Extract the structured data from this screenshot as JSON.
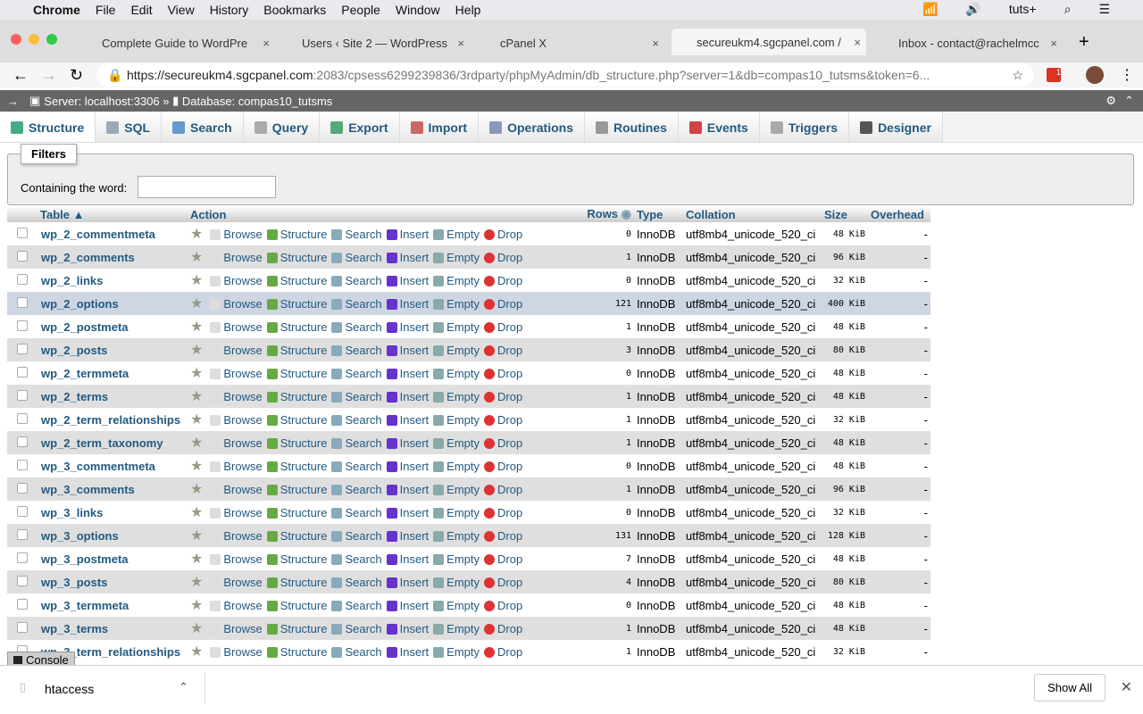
{
  "menubar": {
    "app": "Chrome",
    "items": [
      "File",
      "Edit",
      "View",
      "History",
      "Bookmarks",
      "People",
      "Window",
      "Help"
    ],
    "user": "tuts+"
  },
  "tabs": [
    {
      "title": "Complete Guide to WordPre"
    },
    {
      "title": "Users ‹ Site 2 — WordPress"
    },
    {
      "title": "cPanel X"
    },
    {
      "title": "secureukm4.sgcpanel.com /",
      "active": true
    },
    {
      "title": "Inbox - contact@rachelmcc"
    }
  ],
  "address": {
    "host": "https://secureukm4.sgcpanel.com",
    "path": ":2083/cpsess6299239836/3rdparty/phpMyAdmin/db_structure.php?server=1&db=compas10_tutsms&token=6..."
  },
  "extension_badge": "1",
  "breadcrumb": {
    "server": "Server: localhost:3306",
    "sep": "»",
    "database": "Database: compas10_tutsms"
  },
  "nav": [
    "Structure",
    "SQL",
    "Search",
    "Query",
    "Export",
    "Import",
    "Operations",
    "Routines",
    "Events",
    "Triggers",
    "Designer"
  ],
  "filters": {
    "legend": "Filters",
    "label": "Containing the word:",
    "value": ""
  },
  "columns": {
    "table": "Table",
    "action": "Action",
    "rows": "Rows",
    "type": "Type",
    "collation": "Collation",
    "size": "Size",
    "overhead": "Overhead"
  },
  "actions": [
    "Browse",
    "Structure",
    "Search",
    "Insert",
    "Empty",
    "Drop"
  ],
  "tables": [
    {
      "name": "wp_2_commentmeta",
      "rows": "0",
      "type": "InnoDB",
      "collation": "utf8mb4_unicode_520_ci",
      "size": "48 KiB",
      "overhead": "-"
    },
    {
      "name": "wp_2_comments",
      "rows": "1",
      "type": "InnoDB",
      "collation": "utf8mb4_unicode_520_ci",
      "size": "96 KiB",
      "overhead": "-"
    },
    {
      "name": "wp_2_links",
      "rows": "0",
      "type": "InnoDB",
      "collation": "utf8mb4_unicode_520_ci",
      "size": "32 KiB",
      "overhead": "-"
    },
    {
      "name": "wp_2_options",
      "rows": "121",
      "type": "InnoDB",
      "collation": "utf8mb4_unicode_520_ci",
      "size": "400 KiB",
      "overhead": "-",
      "highlight": true
    },
    {
      "name": "wp_2_postmeta",
      "rows": "1",
      "type": "InnoDB",
      "collation": "utf8mb4_unicode_520_ci",
      "size": "48 KiB",
      "overhead": "-"
    },
    {
      "name": "wp_2_posts",
      "rows": "3",
      "type": "InnoDB",
      "collation": "utf8mb4_unicode_520_ci",
      "size": "80 KiB",
      "overhead": "-"
    },
    {
      "name": "wp_2_termmeta",
      "rows": "0",
      "type": "InnoDB",
      "collation": "utf8mb4_unicode_520_ci",
      "size": "48 KiB",
      "overhead": "-"
    },
    {
      "name": "wp_2_terms",
      "rows": "1",
      "type": "InnoDB",
      "collation": "utf8mb4_unicode_520_ci",
      "size": "48 KiB",
      "overhead": "-"
    },
    {
      "name": "wp_2_term_relationships",
      "rows": "1",
      "type": "InnoDB",
      "collation": "utf8mb4_unicode_520_ci",
      "size": "32 KiB",
      "overhead": "-"
    },
    {
      "name": "wp_2_term_taxonomy",
      "rows": "1",
      "type": "InnoDB",
      "collation": "utf8mb4_unicode_520_ci",
      "size": "48 KiB",
      "overhead": "-"
    },
    {
      "name": "wp_3_commentmeta",
      "rows": "0",
      "type": "InnoDB",
      "collation": "utf8mb4_unicode_520_ci",
      "size": "48 KiB",
      "overhead": "-"
    },
    {
      "name": "wp_3_comments",
      "rows": "1",
      "type": "InnoDB",
      "collation": "utf8mb4_unicode_520_ci",
      "size": "96 KiB",
      "overhead": "-"
    },
    {
      "name": "wp_3_links",
      "rows": "0",
      "type": "InnoDB",
      "collation": "utf8mb4_unicode_520_ci",
      "size": "32 KiB",
      "overhead": "-"
    },
    {
      "name": "wp_3_options",
      "rows": "131",
      "type": "InnoDB",
      "collation": "utf8mb4_unicode_520_ci",
      "size": "128 KiB",
      "overhead": "-"
    },
    {
      "name": "wp_3_postmeta",
      "rows": "7",
      "type": "InnoDB",
      "collation": "utf8mb4_unicode_520_ci",
      "size": "48 KiB",
      "overhead": "-"
    },
    {
      "name": "wp_3_posts",
      "rows": "4",
      "type": "InnoDB",
      "collation": "utf8mb4_unicode_520_ci",
      "size": "80 KiB",
      "overhead": "-"
    },
    {
      "name": "wp_3_termmeta",
      "rows": "0",
      "type": "InnoDB",
      "collation": "utf8mb4_unicode_520_ci",
      "size": "48 KiB",
      "overhead": "-"
    },
    {
      "name": "wp_3_terms",
      "rows": "1",
      "type": "InnoDB",
      "collation": "utf8mb4_unicode_520_ci",
      "size": "48 KiB",
      "overhead": "-"
    },
    {
      "name": "wp_3_term_relationships",
      "rows": "1",
      "type": "InnoDB",
      "collation": "utf8mb4_unicode_520_ci",
      "size": "32 KiB",
      "overhead": "-"
    }
  ],
  "console": "Console",
  "download": {
    "file": "htaccess",
    "show_all": "Show All"
  }
}
